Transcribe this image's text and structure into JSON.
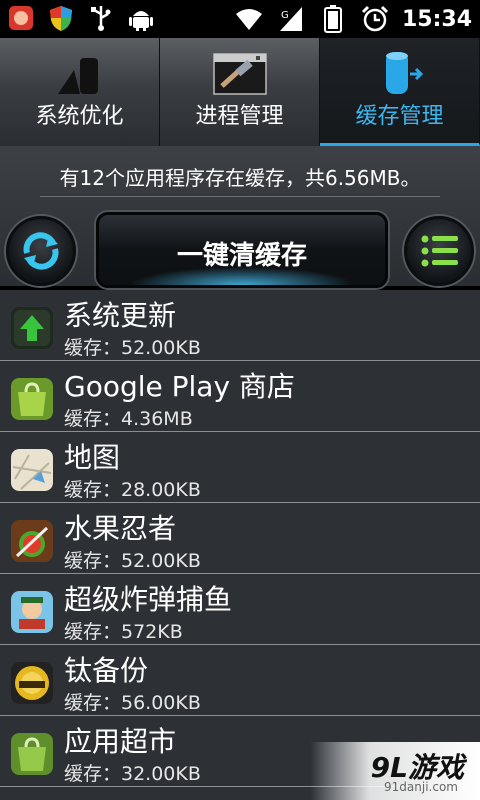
{
  "status_bar": {
    "time": "15:34",
    "left_icons": [
      "app-notification-icon",
      "shield-icon",
      "usb-icon",
      "android-debug-icon"
    ],
    "right_icons": [
      "wifi-icon",
      "signal-icon",
      "battery-icon",
      "alarm-icon"
    ]
  },
  "tabs": [
    {
      "label": "系统优化",
      "icon": "system-optimize-icon",
      "active": false
    },
    {
      "label": "进程管理",
      "icon": "process-manage-icon",
      "active": false
    },
    {
      "label": "缓存管理",
      "icon": "cache-manage-icon",
      "active": true
    }
  ],
  "summary": {
    "text": "有12个应用程序存在缓存，共6.56MB。"
  },
  "actions": {
    "clean_label": "一键清缓存",
    "refresh_icon": "refresh-icon",
    "menu_icon": "menu-list-icon"
  },
  "apps": [
    {
      "name": "系统更新",
      "cache": "缓存：52.00KB",
      "icon": "system-update-icon"
    },
    {
      "name": "Google Play 商店",
      "cache": "缓存：4.36MB",
      "icon": "google-play-icon"
    },
    {
      "name": "地图",
      "cache": "缓存：28.00KB",
      "icon": "maps-icon"
    },
    {
      "name": "水果忍者",
      "cache": "缓存：52.00KB",
      "icon": "fruit-ninja-icon"
    },
    {
      "name": "超级炸弹捕鱼",
      "cache": "缓存：572KB",
      "icon": "fishing-game-icon"
    },
    {
      "name": "钛备份",
      "cache": "缓存：56.00KB",
      "icon": "titanium-backup-icon"
    },
    {
      "name": "应用超市",
      "cache": "缓存：32.00KB",
      "icon": "app-market-icon"
    }
  ],
  "watermark": {
    "logo": "9L游戏",
    "site": "91danji.com"
  },
  "colors": {
    "accent": "#3cb6ef",
    "list_bg": "#2d3136"
  }
}
